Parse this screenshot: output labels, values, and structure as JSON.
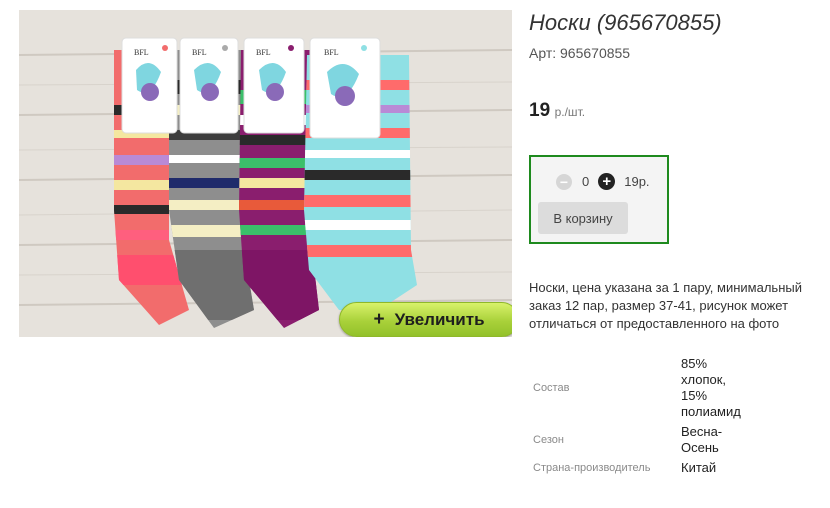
{
  "product": {
    "title": "Носки (965670855)",
    "sku": "Арт: 965670855",
    "price_value": "19",
    "price_unit": "р./шт.",
    "description": "Носки, цена указана за 1 пару, минимальный заказ 12 пар, размер 37-41, рисунок может отличаться от предоставленного на фото"
  },
  "image": {
    "zoom_icon": "+",
    "zoom_label": "Увеличить",
    "tag_brand": "BFL"
  },
  "cart": {
    "minus_icon": "−",
    "quantity": "0",
    "plus_icon": "+",
    "line_total": "19р.",
    "add_button": "В корзину"
  },
  "properties": [
    {
      "label": "Состав",
      "value": "85% хлопок, 15% полиамид"
    },
    {
      "label": "Сезон",
      "value": "Весна-Осень"
    },
    {
      "label": "Страна-производитель",
      "value": "Китай"
    }
  ],
  "colors": {
    "accent_green": "#1e8a1e",
    "zoom_button": "#a9d13a"
  }
}
